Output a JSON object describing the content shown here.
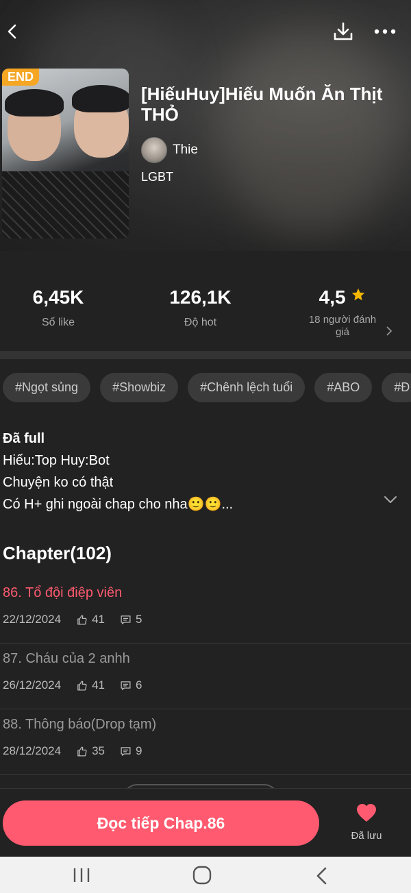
{
  "header": {
    "back_icon": "back-arrow-icon",
    "download_icon": "download-icon",
    "more_icon": "more-dots-icon"
  },
  "book": {
    "badge": "END",
    "title": "[HiếuHuy]Hiếu Muốn Ăn Thịt THỎ",
    "author": "Thie",
    "genre": "LGBT"
  },
  "stats": {
    "likes": "6,45K",
    "likes_label": "Số like",
    "hot": "126,1K",
    "hot_label": "Độ hot",
    "rating": "4,5",
    "rating_label": "18 người đánh giá"
  },
  "tags": [
    "#Ngọt sủng",
    "#Showbiz",
    "#Chênh lệch tuổi",
    "#ABO",
    "#Đ"
  ],
  "description": {
    "line1": "Đã full",
    "line2": "Hiếu:Top Huy:Bot",
    "line3": "Chuyện ko có thật",
    "line4": "Có H+ ghi ngoài chap cho nha🙂🙂..."
  },
  "chapters_title": "Chapter(102)",
  "chapters": [
    {
      "name": "86. Tổ đội điệp viên",
      "date": "22/12/2024",
      "likes": "41",
      "comments": "5"
    },
    {
      "name": "87. Cháu của 2 anhh",
      "date": "26/12/2024",
      "likes": "41",
      "comments": "6"
    },
    {
      "name": "88. Thông báo(Drop tạm)",
      "date": "28/12/2024",
      "likes": "35",
      "comments": "9"
    }
  ],
  "bottom": {
    "read_label": "Đọc tiếp Chap.86",
    "saved_label": "Đã lưu"
  },
  "colors": {
    "accent": "#ff5a6f",
    "badge": "#f5a623",
    "star": "#f5b800"
  }
}
